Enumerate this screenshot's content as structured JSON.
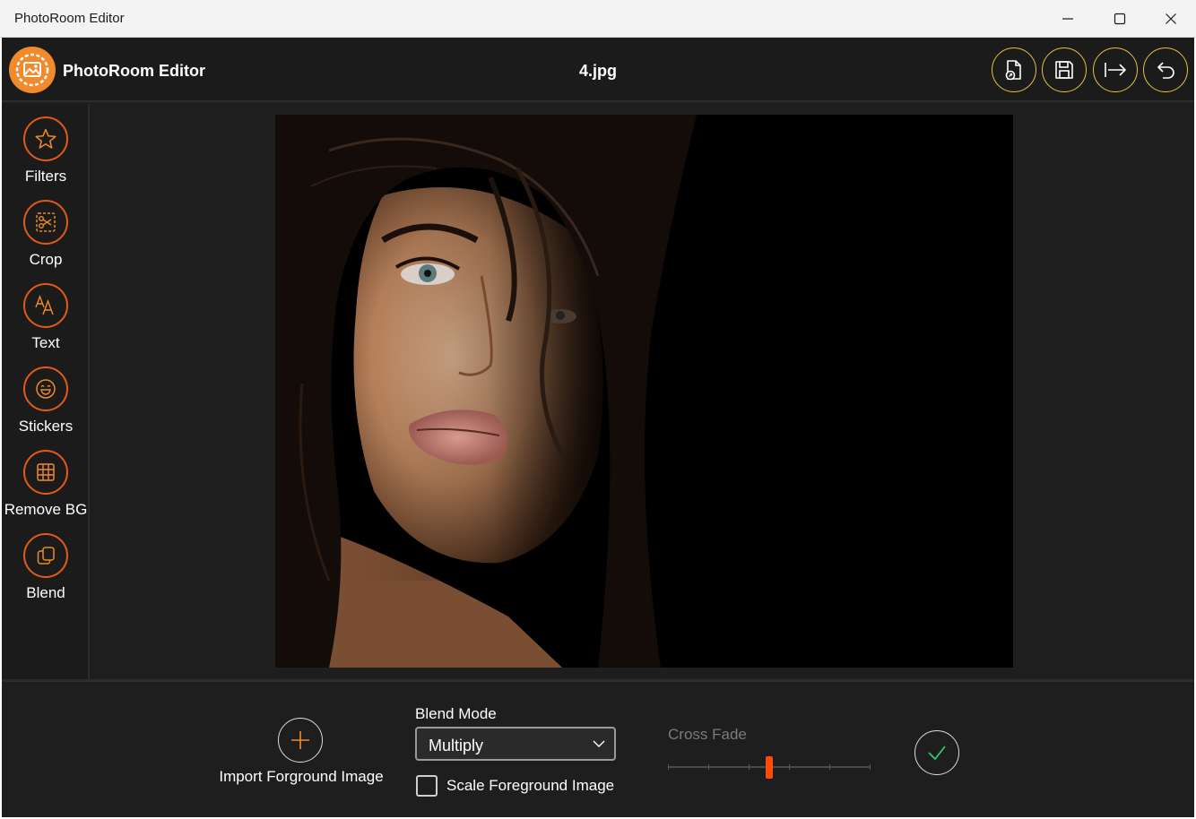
{
  "window": {
    "title": "PhotoRoom Editor",
    "controls": [
      "minimize-icon",
      "maximize-icon",
      "close-icon"
    ]
  },
  "header": {
    "app_name": "PhotoRoom Editor",
    "file_name": "4.jpg",
    "actions": [
      "open-file-icon",
      "save-icon",
      "export-icon",
      "undo-icon"
    ],
    "accent": "#e7c23a"
  },
  "sidebar": {
    "accent": "#e35a18",
    "items": [
      {
        "label": "Filters",
        "icon": "star-icon"
      },
      {
        "label": "Crop",
        "icon": "crop-icon"
      },
      {
        "label": "Text",
        "icon": "text-icon"
      },
      {
        "label": "Stickers",
        "icon": "smiley-icon"
      },
      {
        "label": "Remove BG",
        "icon": "grid-icon"
      },
      {
        "label": "Blend",
        "icon": "copy-icon"
      }
    ]
  },
  "canvas": {
    "image": "portrait photo of a woman with dark hair on a black background"
  },
  "blend_panel": {
    "import_label": "Import Forground Image",
    "blend_mode_label": "Blend Mode",
    "blend_mode_value": "Multiply",
    "scale_label": "Scale Foreground Image",
    "scale_checked": false,
    "cross_fade_label": "Cross Fade",
    "cross_fade_value": 0.5,
    "slider_color": "#ff4a0a"
  }
}
